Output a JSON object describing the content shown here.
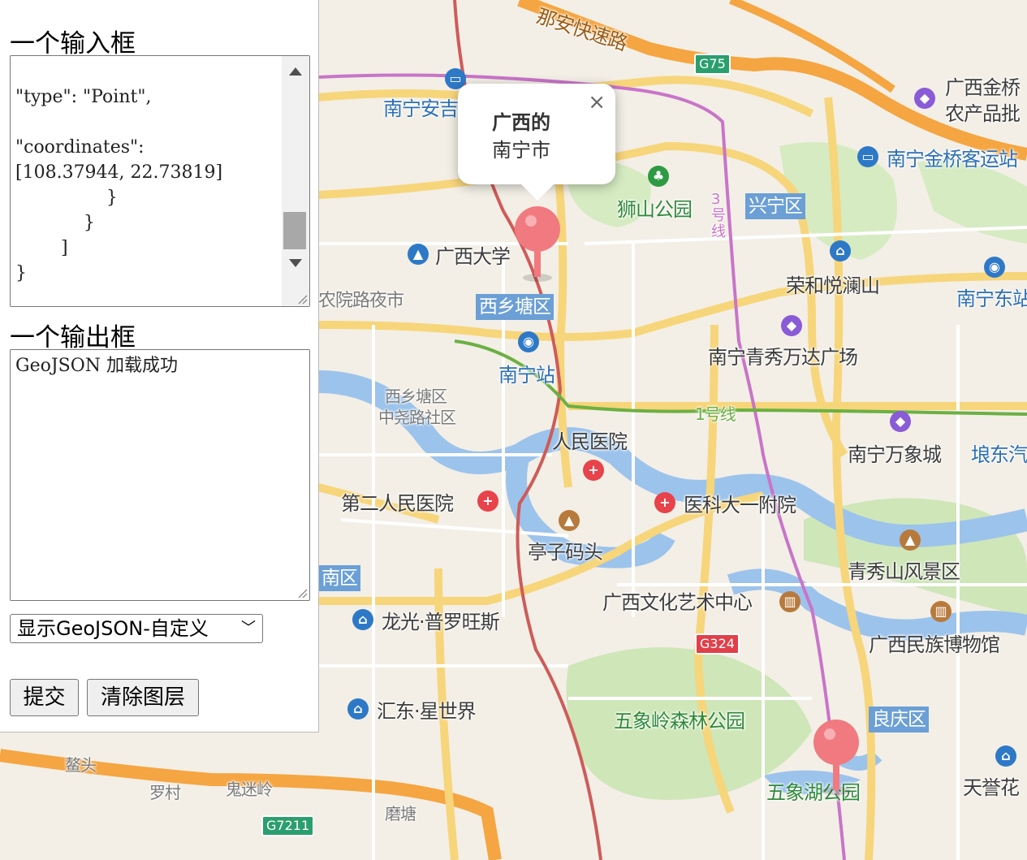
{
  "panel": {
    "input_heading": "一个输入框",
    "input_lines": [
      "",
      "\"type\": \"Point\",",
      "",
      "\"coordinates\":",
      "[108.37944, 22.73819]",
      "                }",
      "            }",
      "        ]",
      "}"
    ],
    "output_heading": "一个输出框",
    "output_value": "GeoJSON 加载成功",
    "select_value": "显示GeoJSON-自定义",
    "submit_label": "提交",
    "clear_label": "清除图层"
  },
  "popup": {
    "title": "广西的",
    "body": "南宁市",
    "close": "×"
  },
  "map_labels": {
    "expressway": "那安快速路",
    "nanning_an": "南宁安吉",
    "jinqiao_market": "广西金桥",
    "jinqiao_market2": "农产品批",
    "jinqiao_station": "南宁金桥客运站",
    "shishan_park": "狮山公园",
    "xingning": "兴宁区",
    "guangxi_univ": "广西大学",
    "rongheyue": "荣和悦澜山",
    "nanning_east": "南宁东站",
    "nongyuan": "农院路夜市",
    "xixiangtang": "西乡塘区",
    "nanning_station": "南宁站",
    "wanda": "南宁青秀万达广场",
    "xixiangtang_sub": "西乡塘区",
    "zhongyao": "中尧路社区",
    "line1": "1号线",
    "line3": "3号线",
    "renmin_hosp": "人民医院",
    "wanxiang": "南宁万象城",
    "ponddong": "埌东汽",
    "second_hosp": "第二人民医院",
    "medical": "医科大一附院",
    "tingzi": "亭子码头",
    "qingxiu": "青秀山风景区",
    "nanqu": "南区",
    "wenhua": "广西文化艺术中心",
    "longguang": "龙光·普罗旺斯",
    "minzu": "广西民族博物馆",
    "huidong": "汇东·星世界",
    "wuxiangling": "五象岭森林公园",
    "liangqing": "良庆区",
    "wuxianghu": "五象湖公园",
    "tianyu": "天誉花",
    "jingtou": "鳌头",
    "luocun": "罗村",
    "guimi": "鬼迷岭",
    "motang": "磨塘"
  },
  "shields": {
    "g75": "G75",
    "g324": "G324",
    "g7211": "G7211"
  }
}
